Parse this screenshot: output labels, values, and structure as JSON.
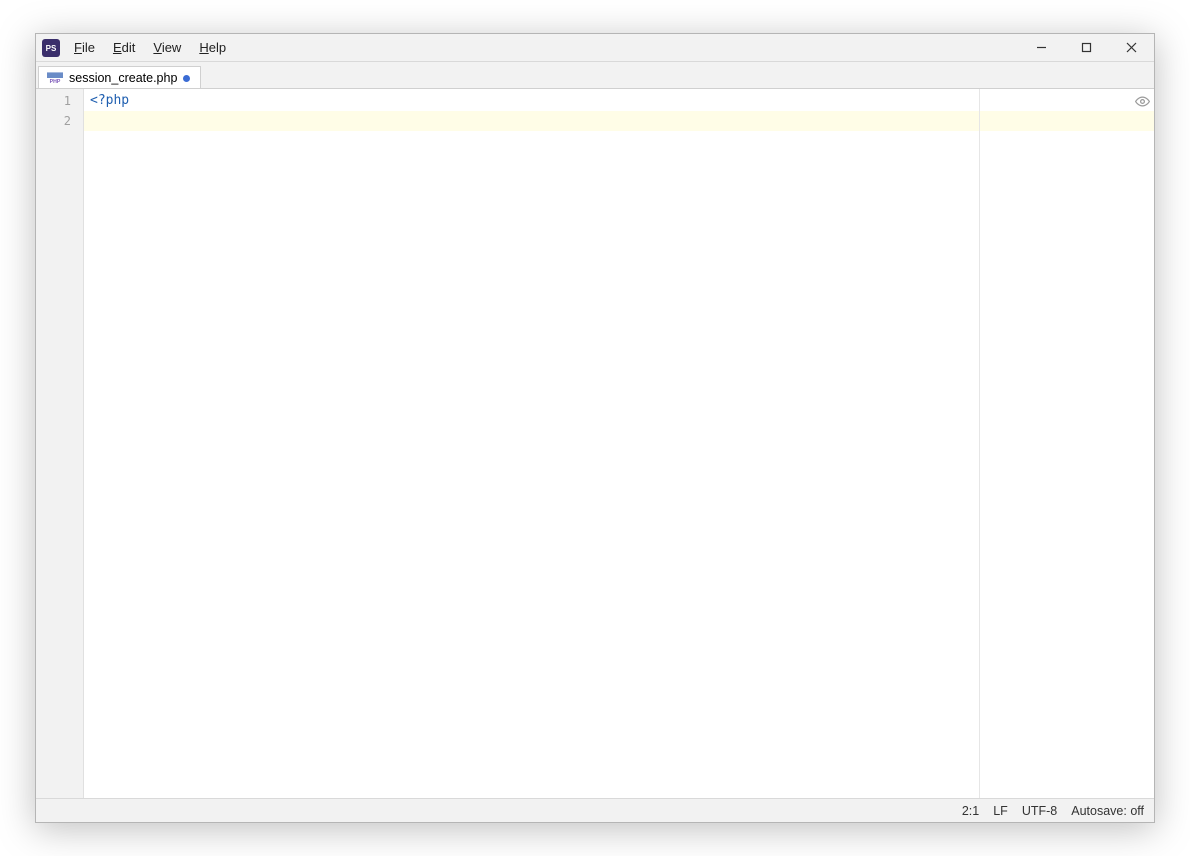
{
  "app_icon_text": "PS",
  "menu": {
    "file": "File",
    "edit": "Edit",
    "view": "View",
    "help": "Help"
  },
  "tab": {
    "filename": "session_create.php",
    "dirty": true,
    "icon": "php-file-icon"
  },
  "editor": {
    "lines": {
      "1": "<?php",
      "2": ""
    },
    "line_numbers": {
      "1": "1",
      "2": "2"
    },
    "active_line": 2
  },
  "statusbar": {
    "cursor_pos": "2:1",
    "line_ending": "LF",
    "encoding": "UTF-8",
    "autosave": "Autosave: off"
  }
}
